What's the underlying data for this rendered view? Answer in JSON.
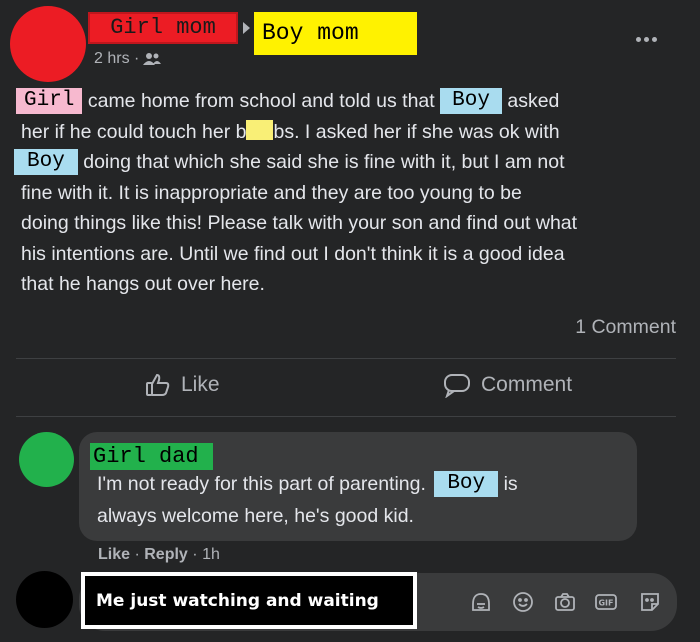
{
  "post": {
    "author_from": "Girl mom",
    "author_to": "Boy mom",
    "time": "2 hrs ·",
    "more_icon": "more-dots",
    "lines": [
      {
        "pre_tag": "Girl",
        "text": "came home from school and told us that",
        "tag2": "Boy",
        "tail": "asked"
      },
      {
        "a": "her if he could touch her b",
        "b": "bs. I asked her if she was ok with"
      },
      {
        "tag": "Boy",
        "text": "doing that which she said she is fine with it, but I am not"
      },
      {
        "text": "fine with it. It is inappropriate and they are too young to be"
      },
      {
        "text": "doing things like this! Please talk with your son and find out what"
      },
      {
        "text": "his intentions are. Until we find out I don't think it is a good idea"
      },
      {
        "text": "that he hangs out over here."
      }
    ],
    "comment_count": "1 Comment"
  },
  "actions": {
    "like_label": "Like",
    "comment_label": "Comment"
  },
  "comment": {
    "author": "Girl dad",
    "line1_text": "I'm not ready for this part of parenting.",
    "line1_tag": "Boy",
    "line1_tail": "is",
    "line2_text": "always welcome here, he's good kid.",
    "like": "Like",
    "reply": "Reply",
    "sep": "·",
    "time": "1h"
  },
  "reply_box": {
    "text": "Me just watching and waiting"
  },
  "colors": {
    "background": "#242526",
    "avatar_girl_mom": "#ec1c24",
    "boy_mom_label": "#fff200",
    "girl_tag": "#f7b9cf",
    "boy_tag": "#a9dcef",
    "avatar_girl_dad": "#22b14c",
    "avatar_reply": "#000000"
  }
}
